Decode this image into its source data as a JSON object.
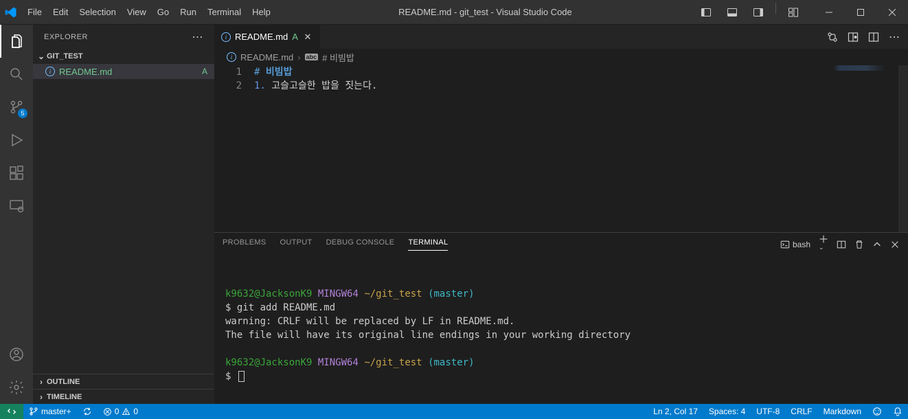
{
  "menubar": [
    "File",
    "Edit",
    "Selection",
    "View",
    "Go",
    "Run",
    "Terminal",
    "Help"
  ],
  "window_title": "README.md - git_test - Visual Studio Code",
  "explorer": {
    "title": "EXPLORER",
    "folder": "GIT_TEST",
    "file": {
      "name": "README.md",
      "status": "A"
    },
    "sections": [
      "OUTLINE",
      "TIMELINE"
    ]
  },
  "scm_badge": "5",
  "tab": {
    "name": "README.md",
    "status": "A"
  },
  "breadcrumb": {
    "file": "README.md",
    "symbol": "# 비빔밥"
  },
  "code": {
    "lines": [
      {
        "num": "1",
        "content_prefix": "# ",
        "content_heading": "비빔밥"
      },
      {
        "num": "2",
        "content_prefix": "1.",
        "content_rest": " 고슬고슬한 밥을 짓는다."
      }
    ]
  },
  "panel": {
    "tabs": [
      "PROBLEMS",
      "OUTPUT",
      "DEBUG CONSOLE",
      "TERMINAL"
    ],
    "active": 3,
    "shell": "bash"
  },
  "terminal": {
    "p1_user": "k9632@JacksonK9",
    "p1_host": "MINGW64",
    "p1_path": "~/git_test",
    "p1_branch": "(master)",
    "cmd1": "$ git add README.md",
    "warn1": "warning: CRLF will be replaced by LF in README.md.",
    "warn2": "The file will have its original line endings in your working directory",
    "prompt2": "$ "
  },
  "status": {
    "branch": "master+",
    "errors": "0",
    "warnings": "0",
    "lncol": "Ln 2, Col 17",
    "spaces": "Spaces: 4",
    "encoding": "UTF-8",
    "eol": "CRLF",
    "lang": "Markdown"
  }
}
